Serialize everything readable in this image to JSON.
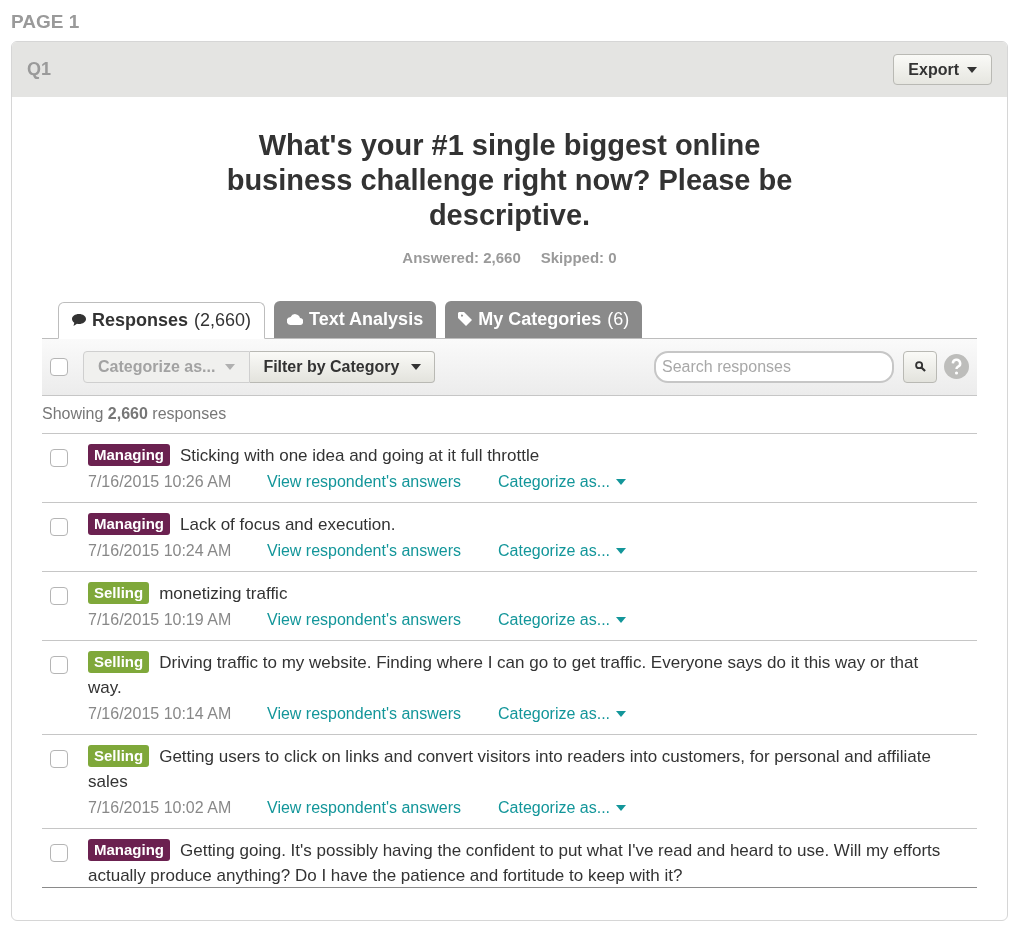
{
  "page_title": "PAGE 1",
  "question": {
    "number": "Q1",
    "export_label": "Export",
    "title": "What's your #1 single biggest online business challenge right now? Please be descriptive.",
    "stats": [
      {
        "label": "Answered:",
        "value": "2,660"
      },
      {
        "label": "Skipped:",
        "value": "0"
      }
    ]
  },
  "tabs": [
    {
      "kind": "responses",
      "label": "Responses",
      "count": "(2,660)",
      "selected": true
    },
    {
      "kind": "analysis",
      "label": "Text Analysis",
      "selected": false
    },
    {
      "kind": "categories",
      "label": "My Categories",
      "count": "(6)",
      "selected": false
    }
  ],
  "toolbar": {
    "select_all_checked": false,
    "categorize_label": "Categorize as...",
    "categorize_disabled": true,
    "filter_label": "Filter by Category",
    "search_placeholder": "Search responses"
  },
  "showing": "Showing **2,660** responses",
  "responses": [
    {
      "checked": false,
      "tag": "Managing",
      "color": "#6b2150",
      "text": "Sticking with one idea and going at it full throttle",
      "date": "7/16/2015 10:26 AM",
      "view_link": "View respondent's answers",
      "categorize": "Categorize as..."
    },
    {
      "checked": false,
      "tag": "Managing",
      "color": "#6b2150",
      "text": "Lack of focus and execution.",
      "date": "7/16/2015 10:24 AM",
      "view_link": "View respondent's answers",
      "categorize": "Categorize as..."
    },
    {
      "checked": false,
      "tag": "Selling",
      "color": "#7fa83a",
      "text": "monetizing traffic",
      "date": "7/16/2015 10:19 AM",
      "view_link": "View respondent's answers",
      "categorize": "Categorize as..."
    },
    {
      "checked": false,
      "tag": "Selling",
      "color": "#7fa83a",
      "text": "Driving traffic to my website. Finding where I can go to get traffic. Everyone says do it this way or that way.",
      "date": "7/16/2015 10:14 AM",
      "view_link": "View respondent's answers",
      "categorize": "Categorize as..."
    },
    {
      "checked": false,
      "tag": "Selling",
      "color": "#7fa83a",
      "text": "Getting users to click on links and convert visitors into readers into customers, for personal and affiliate sales",
      "date": "7/16/2015 10:02 AM",
      "view_link": "View respondent's answers",
      "categorize": "Categorize as..."
    },
    {
      "checked": false,
      "tag": "Managing",
      "color": "#6b2150",
      "text": "Getting going. It's possibly having the confident to put what I've read and heard to use. Will my efforts actually produce anything? Do I have the patience and fortitude to keep with it?"
    }
  ]
}
